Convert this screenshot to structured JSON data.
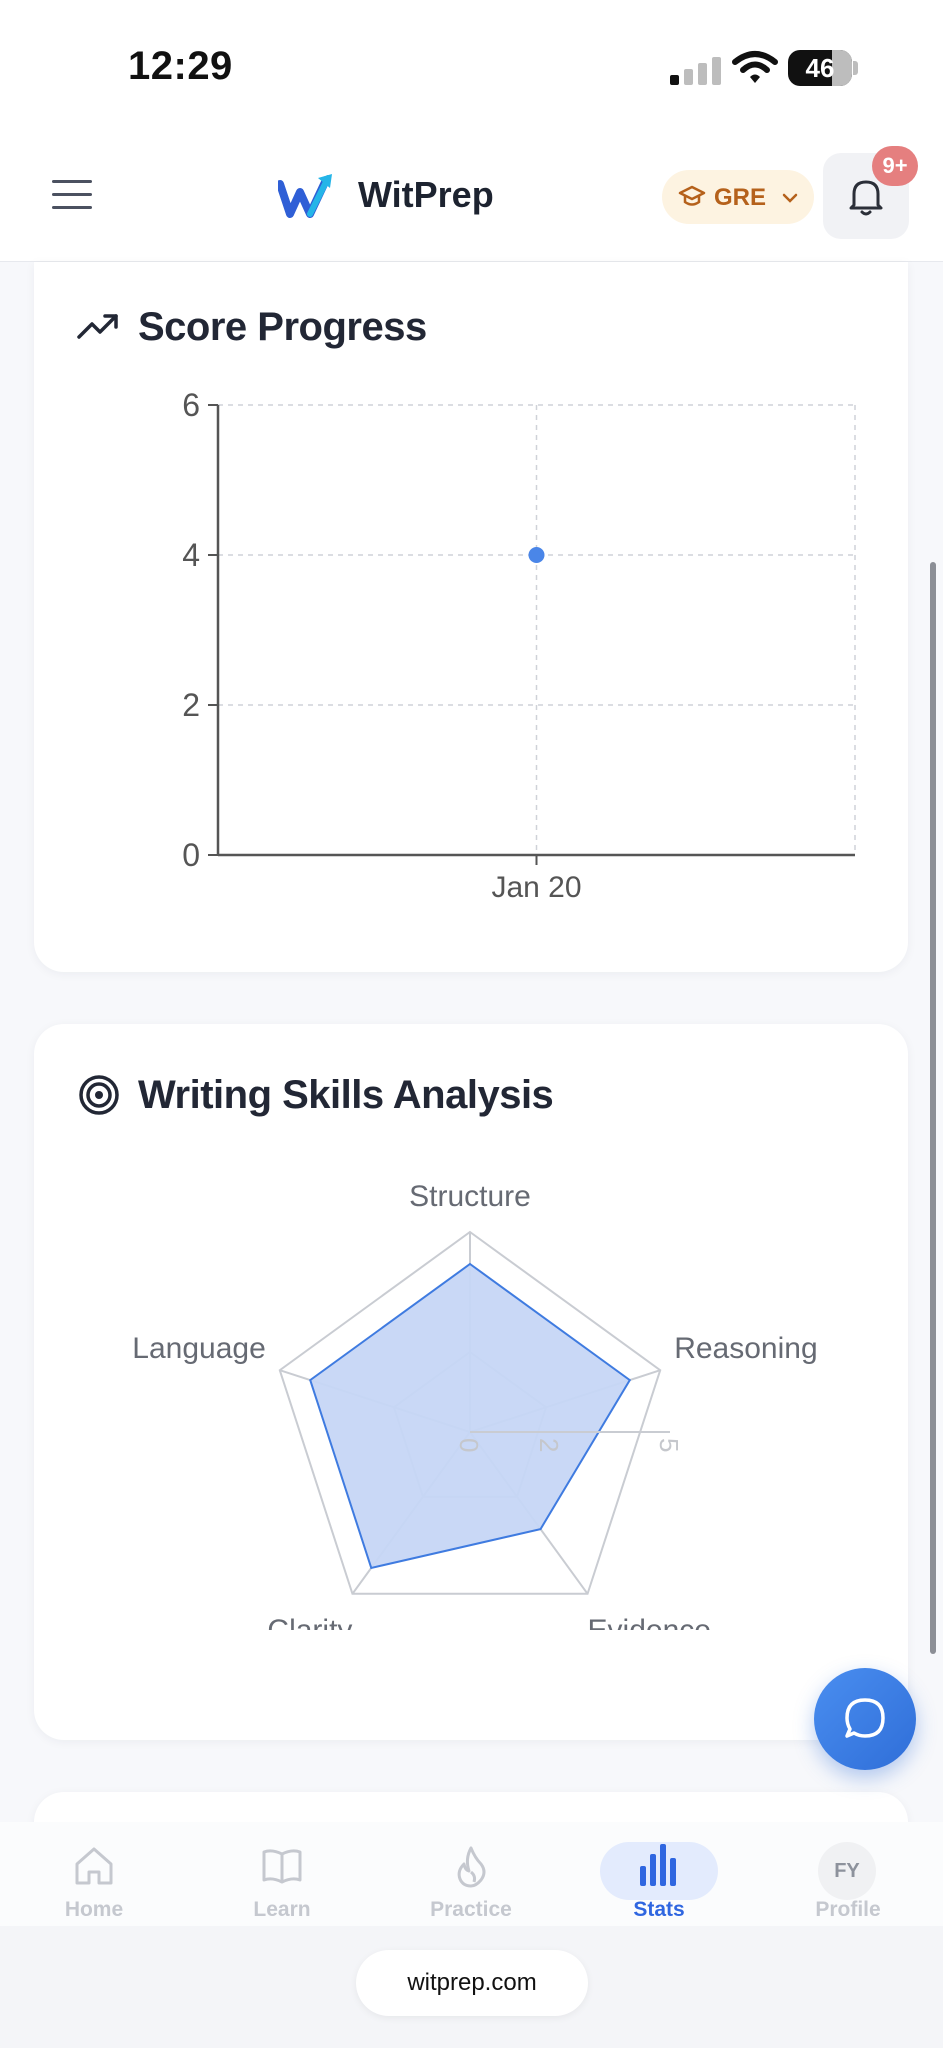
{
  "status_bar": {
    "time": "12:29",
    "battery": "46"
  },
  "header": {
    "brand": "WitPrep",
    "exam": "GRE",
    "notification_badge": "9+"
  },
  "score_progress": {
    "title": "Score Progress",
    "chart_data": {
      "type": "scatter",
      "categories": [
        "Jan 20"
      ],
      "values": [
        4
      ],
      "ylim": [
        0,
        6
      ],
      "yticks": [
        0,
        2,
        4,
        6
      ],
      "grid": true,
      "color": "#4a86e8"
    }
  },
  "writing_skills": {
    "title": "Writing Skills Analysis",
    "chart_data": {
      "type": "radar",
      "axes": [
        "Structure",
        "Reasoning",
        "Evidence",
        "Clarity",
        "Language"
      ],
      "values": [
        4.2,
        4.2,
        3.0,
        4.2,
        4.2
      ],
      "rmax": 5,
      "ticks": [
        0,
        2,
        5
      ],
      "fill": "#c6d6f5",
      "stroke": "#3f7be0"
    }
  },
  "bottom_nav": {
    "home": "Home",
    "learn": "Learn",
    "practice": "Practice",
    "stats": "Stats",
    "profile": "Profile",
    "profile_initials": "FY"
  },
  "browser": {
    "url": "witprep.com"
  }
}
